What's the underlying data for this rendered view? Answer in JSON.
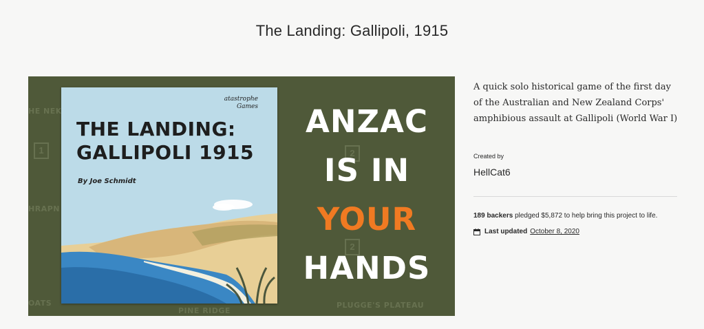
{
  "project": {
    "title": "The Landing: Gallipoli, 1915",
    "description": "A quick solo historical game of the first day of the Australian and New Zealand Corps' amphibious assault at Gallipoli (World War I)",
    "created_by_label": "Created by",
    "creator": "HellCat6",
    "backers_count": "189 backers",
    "pledged_text": "pledged $5,872 to help bring this project to life.",
    "last_updated_label": "Last updated",
    "last_updated_date": "October 8, 2020",
    "calendar_icon": "calendar-icon"
  },
  "hero": {
    "cover_title_line1": "THE LANDING:",
    "cover_title_line2": "GALLIPOLI 1915",
    "cover_author": "By Joe Schmidt",
    "publisher_line1": "atastrophe",
    "publisher_line2": "Games",
    "headline_line1": "ANZAC",
    "headline_line2": "IS IN",
    "headline_line3": "YOUR",
    "headline_line4": "HANDS",
    "map_labels": [
      "HE NEK",
      "HRAPN",
      "OATS",
      "PINE RIDGE",
      "PLUGGE'S PLATEAU"
    ],
    "map_numbers": [
      "1",
      "2",
      "2"
    ],
    "colors": {
      "background": "#4f5939",
      "headline": "#ffffff",
      "accent": "#f07a22"
    }
  }
}
